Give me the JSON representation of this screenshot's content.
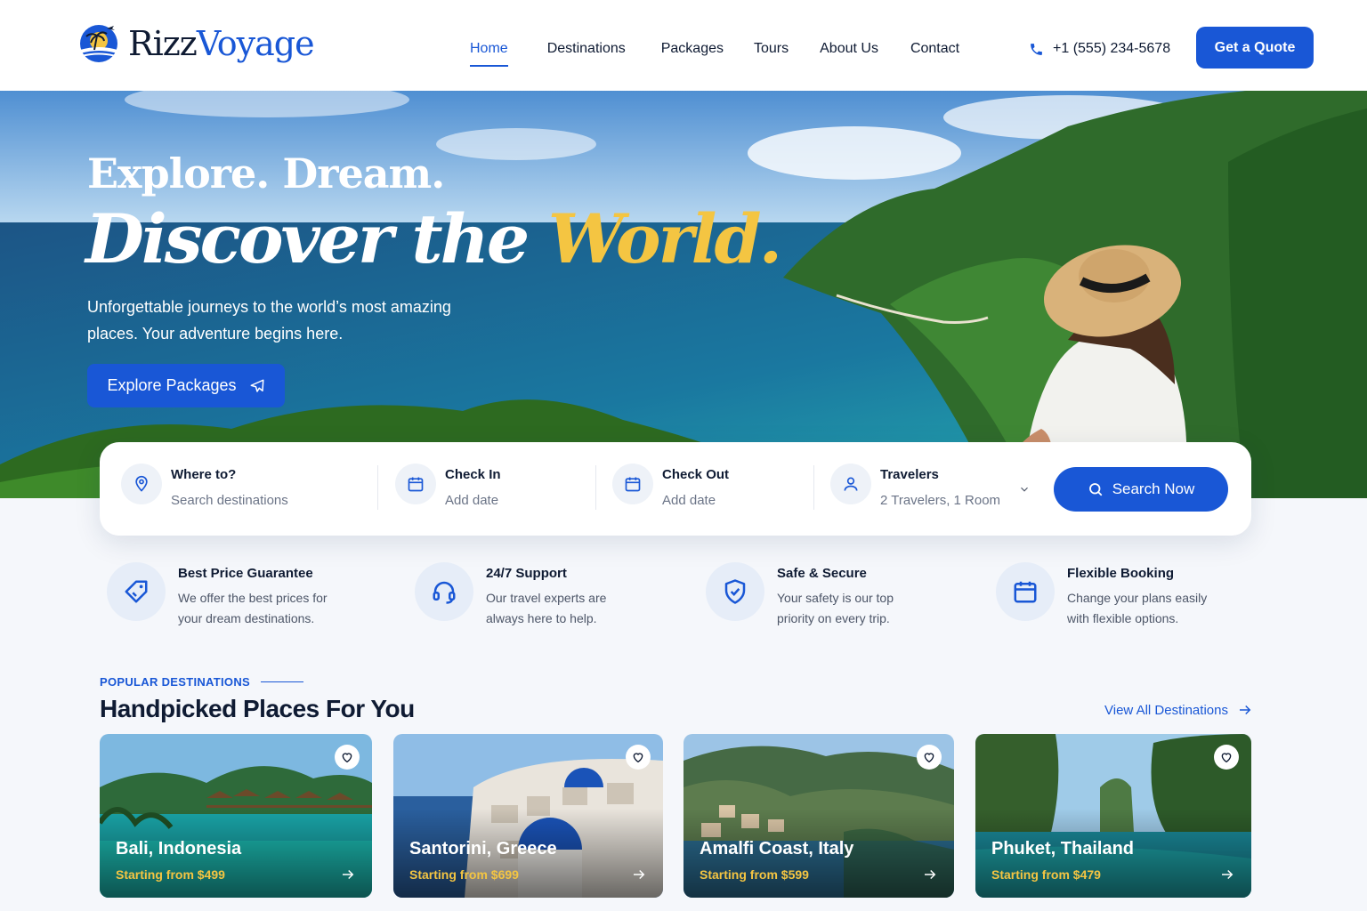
{
  "brand": {
    "name_part1": "Rizz",
    "name_part2": "Voyage",
    "logo": "palm-island-logo"
  },
  "nav": {
    "items": [
      {
        "label": "Home",
        "active": true
      },
      {
        "label": "Destinations",
        "active": false
      },
      {
        "label": "Packages",
        "active": false
      },
      {
        "label": "Tours",
        "active": false
      },
      {
        "label": "About Us",
        "active": false
      },
      {
        "label": "Contact",
        "active": false
      }
    ],
    "phone": "+1 (555) 234-5678",
    "cta": "Get a Quote"
  },
  "hero": {
    "line1": "Explore. Dream.",
    "line2_white": "Discover the ",
    "line2_yellow": "World.",
    "subtitle": "Unforgettable journeys to the world’s most amazing places. Your adventure begins here.",
    "button": "Explore Packages"
  },
  "search": {
    "where": {
      "label": "Where to?",
      "placeholder": "Search destinations"
    },
    "checkin": {
      "label": "Check In",
      "placeholder": "Add date"
    },
    "checkout": {
      "label": "Check Out",
      "placeholder": "Add date"
    },
    "travelers": {
      "label": "Travelers",
      "value": "2 Travelers, 1 Room"
    },
    "button": "Search Now"
  },
  "features": [
    {
      "title": "Best Price Guarantee",
      "desc": "We offer the best prices for your dream destinations.",
      "icon": "price-tag-icon"
    },
    {
      "title": "24/7 Support",
      "desc": "Our travel experts are always here to help.",
      "icon": "headset-icon"
    },
    {
      "title": "Safe & Secure",
      "desc": "Your safety is our top priority on every trip.",
      "icon": "shield-check-icon"
    },
    {
      "title": "Flexible Booking",
      "desc": "Change your plans easily with flexible options.",
      "icon": "calendar-icon"
    }
  ],
  "destinations": {
    "eyebrow": "POPULAR DESTINATIONS",
    "title": "Handpicked Places For You",
    "view_all": "View All Destinations",
    "cards": [
      {
        "name": "Bali, Indonesia",
        "price": "Starting from $499"
      },
      {
        "name": "Santorini, Greece",
        "price": "Starting from $699"
      },
      {
        "name": "Amalfi Coast, Italy",
        "price": "Starting from $599"
      },
      {
        "name": "Phuket, Thailand",
        "price": "Starting from $479"
      }
    ]
  },
  "colors": {
    "primary": "#1957d6",
    "accent": "#f4c542",
    "text": "#0f1b33"
  }
}
